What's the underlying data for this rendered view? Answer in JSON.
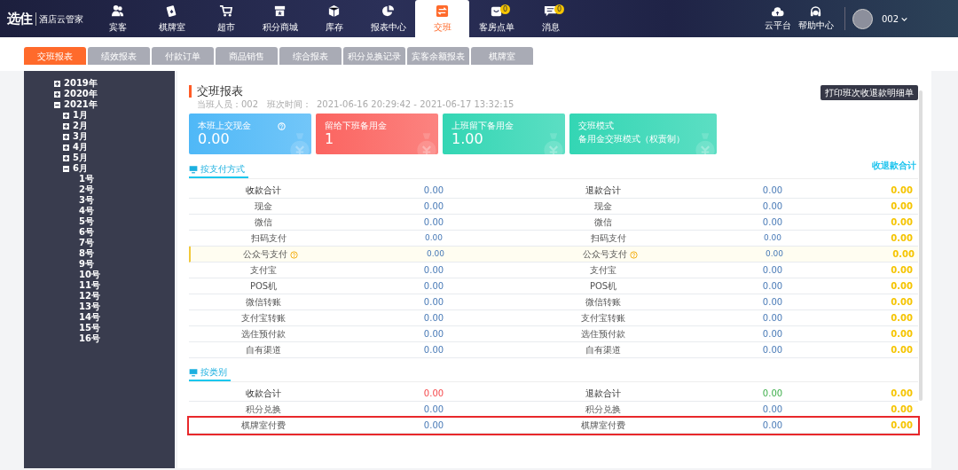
{
  "brand": {
    "logo": "选住",
    "name": "酒店云管家"
  },
  "nav": [
    {
      "label": "宾客",
      "selected": false
    },
    {
      "label": "棋牌室",
      "selected": false
    },
    {
      "label": "超市",
      "selected": false
    },
    {
      "label": "积分商城",
      "selected": false
    },
    {
      "label": "库存",
      "selected": false
    },
    {
      "label": "报表中心",
      "selected": false
    },
    {
      "label": "交班",
      "selected": true
    },
    {
      "label": "客房点单",
      "selected": false,
      "badge": "0"
    },
    {
      "label": "消息",
      "selected": false,
      "badge": "0"
    }
  ],
  "tools": [
    {
      "label": "云平台"
    },
    {
      "label": "帮助中心"
    }
  ],
  "user": {
    "name": "002"
  },
  "tabs": [
    {
      "label": "交班报表",
      "selected": true
    },
    {
      "label": "绩效报表",
      "selected": false
    },
    {
      "label": "付款订单",
      "selected": false
    },
    {
      "label": "商品销售",
      "selected": false
    },
    {
      "label": "综合报表",
      "selected": false
    },
    {
      "label": "积分兑换记录",
      "selected": false
    },
    {
      "label": "宾客余额报表",
      "selected": false
    },
    {
      "label": "棋牌室",
      "selected": false
    }
  ],
  "tree": [
    {
      "label": "2019年",
      "expanded": false
    },
    {
      "label": "2020年",
      "expanded": false
    },
    {
      "label": "2021年",
      "expanded": true,
      "children": [
        {
          "label": "1月",
          "expanded": false
        },
        {
          "label": "2月",
          "expanded": false
        },
        {
          "label": "3月",
          "expanded": false
        },
        {
          "label": "4月",
          "expanded": false
        },
        {
          "label": "5月",
          "expanded": false
        },
        {
          "label": "6月",
          "expanded": true,
          "children": [
            {
              "label": "1号"
            },
            {
              "label": "2号"
            },
            {
              "label": "3号"
            },
            {
              "label": "4号"
            },
            {
              "label": "5号"
            },
            {
              "label": "6号"
            },
            {
              "label": "7号"
            },
            {
              "label": "8号"
            },
            {
              "label": "9号"
            },
            {
              "label": "10号"
            },
            {
              "label": "11号"
            },
            {
              "label": "12号"
            },
            {
              "label": "13号"
            },
            {
              "label": "14号"
            },
            {
              "label": "15号"
            },
            {
              "label": "16号"
            }
          ]
        }
      ]
    }
  ],
  "report": {
    "title": "交班报表",
    "meta": "当班人员：002   班次时间：  2021-06-16 20:29:42 - 2021-06-17 13:32:15",
    "print_button": "打印班次收退款明细单"
  },
  "cards": [
    {
      "kind": "amount",
      "label": "本班上交现金",
      "value": "0.00",
      "color": "#4fb8f7",
      "help": true
    },
    {
      "kind": "amount",
      "label": "留给下班备用金",
      "value": "1",
      "color": "#fb6460",
      "help": false
    },
    {
      "kind": "amount",
      "label": "上班留下备用金",
      "value": "1.00",
      "color": "#33d6b4",
      "help": false
    },
    {
      "kind": "mode",
      "label": "交班模式",
      "value": "备用金交班模式（权责制）",
      "color": "#33d6b4",
      "help": false
    }
  ],
  "sections": [
    {
      "title": "按支付方式",
      "total_heading": "收退款合计",
      "rows": [
        {
          "kind": "total",
          "label_in": "收款合计",
          "value_in": "0.00",
          "label_out": "退款合计",
          "value_out": "0.00",
          "total": "0.00"
        },
        {
          "kind": "normal",
          "label_in": "现金",
          "value_in": "0.00",
          "label_out": "现金",
          "value_out": "0.00",
          "total": "0.00"
        },
        {
          "kind": "normal",
          "label_in": "微信",
          "value_in": "0.00",
          "label_out": "微信",
          "value_out": "0.00",
          "total": "0.00"
        },
        {
          "kind": "sub",
          "label_in": "扫码支付",
          "value_in": "0.00",
          "label_out": "扫码支付",
          "value_out": "0.00",
          "total": "0.00"
        },
        {
          "kind": "sub",
          "label_in": "公众号支付",
          "value_in": "0.00",
          "label_out": "公众号支付",
          "value_out": "0.00",
          "total": "0.00",
          "help": true,
          "highlighted": true
        },
        {
          "kind": "normal",
          "label_in": "支付宝",
          "value_in": "0.00",
          "label_out": "支付宝",
          "value_out": "0.00",
          "total": "0.00"
        },
        {
          "kind": "normal",
          "label_in": "POS机",
          "value_in": "0.00",
          "label_out": "POS机",
          "value_out": "0.00",
          "total": "0.00"
        },
        {
          "kind": "normal",
          "label_in": "微信转账",
          "value_in": "0.00",
          "label_out": "微信转账",
          "value_out": "0.00",
          "total": "0.00"
        },
        {
          "kind": "normal",
          "label_in": "支付宝转账",
          "value_in": "0.00",
          "label_out": "支付宝转账",
          "value_out": "0.00",
          "total": "0.00"
        },
        {
          "kind": "normal",
          "label_in": "选住预付款",
          "value_in": "0.00",
          "label_out": "选住预付款",
          "value_out": "0.00",
          "total": "0.00"
        },
        {
          "kind": "normal",
          "label_in": "自有渠道",
          "value_in": "0.00",
          "label_out": "自有渠道",
          "value_out": "0.00",
          "total": "0.00"
        }
      ]
    },
    {
      "title": "按类别",
      "rows": [
        {
          "kind": "total",
          "label_in": "收款合计",
          "value_in": "0.00",
          "in_value_color": {
            "color": "#f5484b"
          },
          "label_out": "退款合计",
          "value_out": "0.00",
          "out_value_color": {
            "color": "#3dae4a"
          },
          "total": "0.00"
        },
        {
          "kind": "normal",
          "label_in": "积分兑换",
          "value_in": "0.00",
          "label_out": "积分兑换",
          "value_out": "0.00",
          "total": "0.00"
        },
        {
          "kind": "normal",
          "label_in": "棋牌室付费",
          "value_in": "0.00",
          "label_out": "棋牌室付费",
          "value_out": "0.00",
          "total": "0.00",
          "marked": true
        }
      ]
    }
  ]
}
